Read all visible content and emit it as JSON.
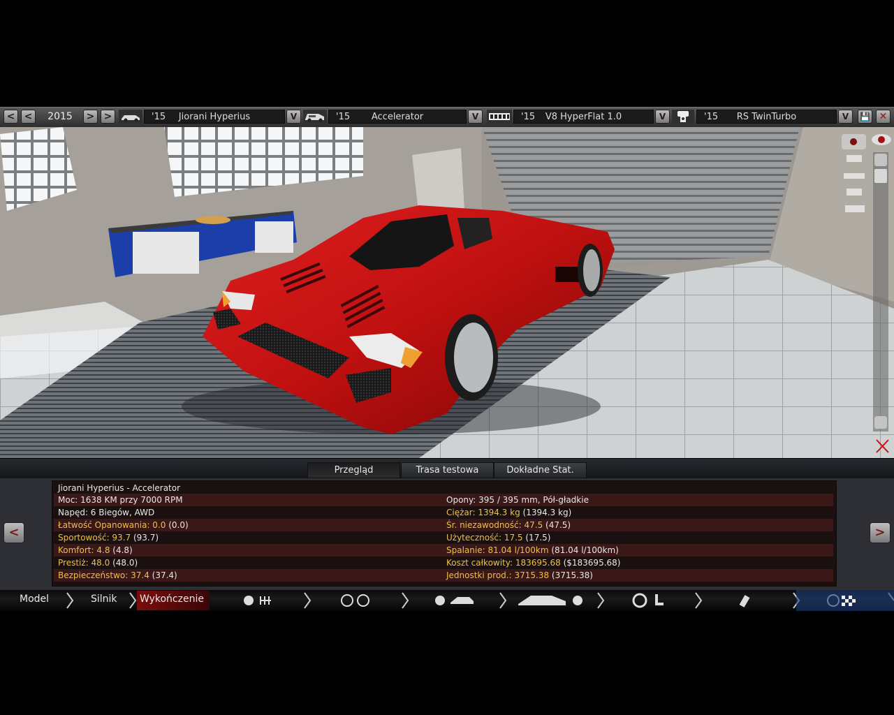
{
  "topbar": {
    "year": "2015",
    "model": {
      "year": "'15",
      "name": "Jiorani Hyperius"
    },
    "trim": {
      "year": "'15",
      "name": "Accelerator"
    },
    "engine": {
      "year": "'15",
      "name": "V8 HyperFlat 1.0"
    },
    "variant": {
      "year": "'15",
      "name": "RS TwinTurbo"
    },
    "prev_label": "<",
    "next_label": ">",
    "dropdown_label": "V",
    "save_label": "💾",
    "close_label": "✕"
  },
  "tabs": [
    "Przegląd",
    "Trasa testowa",
    "Dokładne Stat."
  ],
  "stats": {
    "title": "Jiorani Hyperius - Accelerator",
    "left": [
      {
        "k": "",
        "v": "Moc: 1638 KM przy 7000 RPM"
      },
      {
        "k": "",
        "v": "Napęd: 6 Biegów, AWD"
      },
      {
        "k": "Łatwość Opanowania: 0.0",
        "v": "(0.0)"
      },
      {
        "k": "Sportowość: 93.7",
        "v": "(93.7)"
      },
      {
        "k": "Komfort: 4.8",
        "v": "(4.8)"
      },
      {
        "k": "Prestiż: 48.0",
        "v": "(48.0)"
      },
      {
        "k": "Bezpieczeństwo: 37.4",
        "v": "(37.4)"
      }
    ],
    "right": [
      {
        "k": "",
        "v": "Opony: 395 / 395 mm, Pół-gładkie"
      },
      {
        "k": "Ciężar: 1394.3 kg",
        "v": "(1394.3 kg)"
      },
      {
        "k": "Śr. niezawodność: 47.5",
        "v": "(47.5)"
      },
      {
        "k": "Użyteczność: 17.5",
        "v": "(17.5)"
      },
      {
        "k": "Spalanie: 81.04 l/100km",
        "v": "(81.04 l/100km)"
      },
      {
        "k": "Koszt całkowity: 183695.68",
        "v": "($183695.68)"
      },
      {
        "k": "Jednostki prod.: 3715.38",
        "v": "(3715.38)"
      }
    ]
  },
  "bottomnav": {
    "model": "Model",
    "engine": "Silnik",
    "finish": "Wykończenie"
  },
  "colors": {
    "car": "#c81010",
    "highlight": "#f0c040",
    "panel": "#1a1010"
  }
}
